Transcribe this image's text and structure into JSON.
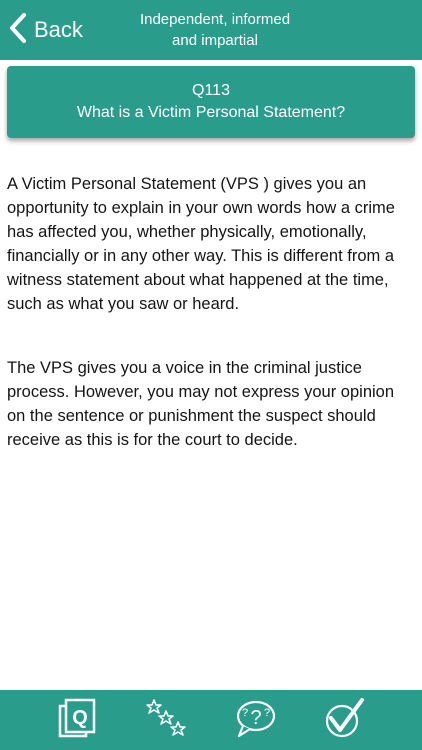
{
  "colors": {
    "teal": "#2a9c8c",
    "text": "#141414",
    "on_accent": "#ffffff"
  },
  "header": {
    "back_label": "Back",
    "back_icon": "chevron-left-icon",
    "tagline_line1": "Independent, informed",
    "tagline_line2": "and impartial"
  },
  "question": {
    "number": "Q113",
    "title": "What is a Victim Personal Statement?"
  },
  "answer": {
    "paragraphs": [
      "A Victim Personal Statement (VPS ) gives you an opportunity to explain in your own words how a crime has affected you, whether physically, emotionally, financially or in any other way. This is different from a witness statement about what happened at the time, such as what you saw or heard.",
      "The VPS gives you a voice in the criminal justice process. However, you may not express your opinion on the sentence or punishment the suspect should receive as this is for the court to decide."
    ]
  },
  "tabbar": {
    "tabs": [
      {
        "icon": "questions-icon"
      },
      {
        "icon": "favourites-stars-icon"
      },
      {
        "icon": "help-bubble-icon"
      },
      {
        "icon": "quiz-check-icon"
      }
    ]
  }
}
